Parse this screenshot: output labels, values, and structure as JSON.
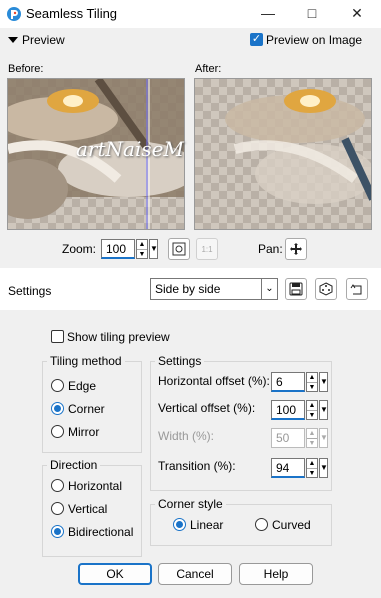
{
  "window": {
    "title": "Seamless Tiling"
  },
  "preview_section": {
    "label": "Preview",
    "preview_on_image_label": "Preview on Image",
    "preview_on_image_checked": true
  },
  "panes": {
    "before_label": "Before:",
    "after_label": "After:",
    "watermark": "artNaiseM"
  },
  "zoom": {
    "label": "Zoom:",
    "value": "100"
  },
  "pan": {
    "label": "Pan:"
  },
  "settings_bar": {
    "label": "Settings",
    "preset": "Side by side"
  },
  "show_tiling_preview": {
    "label": "Show tiling preview",
    "checked": false
  },
  "tiling_method": {
    "title": "Tiling method",
    "options": [
      "Edge",
      "Corner",
      "Mirror"
    ],
    "selected": "Corner"
  },
  "direction": {
    "title": "Direction",
    "options": [
      "Horizontal",
      "Vertical",
      "Bidirectional"
    ],
    "selected": "Bidirectional"
  },
  "settings": {
    "title": "Settings",
    "horizontal_offset": {
      "label": "Horizontal offset (%):",
      "value": "6"
    },
    "vertical_offset": {
      "label": "Vertical offset (%):",
      "value": "100"
    },
    "width": {
      "label": "Width (%):",
      "value": "50"
    },
    "transition": {
      "label": "Transition (%):",
      "value": "94"
    }
  },
  "corner_style": {
    "title": "Corner style",
    "options": [
      "Linear",
      "Curved"
    ],
    "selected": "Linear"
  },
  "buttons": {
    "ok": "OK",
    "cancel": "Cancel",
    "help": "Help"
  },
  "colors": {
    "accent": "#1a73c8",
    "panel": "#f0f0f0"
  }
}
